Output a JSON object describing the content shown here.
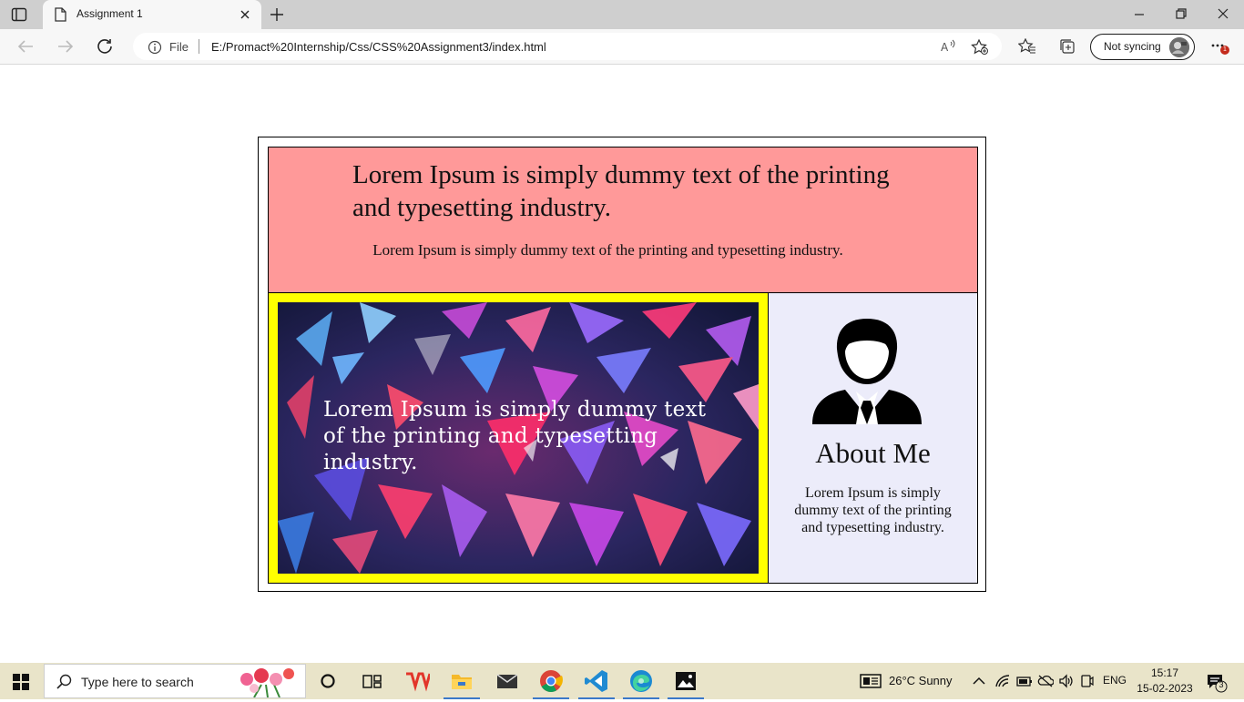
{
  "browser": {
    "tab_title": "Assignment 1",
    "address_scheme": "File",
    "address_url": "E:/Promact%20Internship/Css/CSS%20Assignment3/index.html",
    "sync_label": "Not syncing",
    "menu_badge": "1"
  },
  "page": {
    "header_title": "Lorem Ipsum is simply dummy text of the printing and typesetting industry.",
    "header_subtitle": "Lorem Ipsum is simply dummy text of the printing and typesetting industry.",
    "banner_text": "Lorem Ipsum is simply dummy text of the printing and typesetting industry.",
    "about_title": "About Me",
    "about_text": "Lorem Ipsum is simply dummy text of the printing and typesetting industry.",
    "colors": {
      "header_bg": "#ff9999",
      "banner_frame": "#ffff00",
      "about_bg": "#ececfa"
    }
  },
  "taskbar": {
    "search_placeholder": "Type here to search",
    "weather": "26°C  Sunny",
    "language": "ENG",
    "time": "15:17",
    "date": "15-02-2023",
    "notification_count": "3",
    "apps": [
      "task-view-icon",
      "wps-office-icon",
      "file-explorer-icon",
      "mail-icon",
      "chrome-icon",
      "vscode-icon",
      "edge-icon",
      "photos-icon"
    ]
  }
}
